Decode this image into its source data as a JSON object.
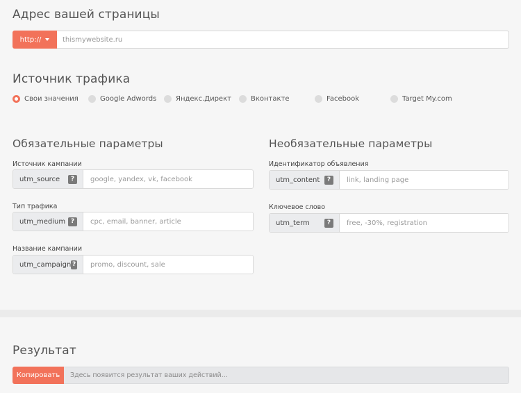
{
  "address": {
    "title": "Адрес вашей страницы",
    "protocol": "http://",
    "url_placeholder": "thismywebsite.ru"
  },
  "traffic": {
    "title": "Источник трафика",
    "options": [
      {
        "label": "Свои значения",
        "selected": true
      },
      {
        "label": "Google Adwords",
        "selected": false
      },
      {
        "label": "Яндекс.Директ",
        "selected": false
      },
      {
        "label": "Вконтакте",
        "selected": false
      },
      {
        "label": "Facebook",
        "selected": false
      },
      {
        "label": "Target My.com",
        "selected": false
      }
    ]
  },
  "required": {
    "title": "Обязательные параметры",
    "fields": [
      {
        "label": "Источник кампании",
        "param": "utm_source",
        "placeholder": "google, yandex, vk, facebook",
        "help": "?"
      },
      {
        "label": "Тип трафика",
        "param": "utm_medium",
        "placeholder": "cpc, email, banner, article",
        "help": "?"
      },
      {
        "label": "Название кампании",
        "param": "utm_campaign",
        "placeholder": "promo, discount, sale",
        "help": "?"
      }
    ]
  },
  "optional": {
    "title": "Необязательные параметры",
    "fields": [
      {
        "label": "Идентификатор объявления",
        "param": "utm_content",
        "placeholder": "link, landing page",
        "help": "?"
      },
      {
        "label": "Ключевое слово",
        "param": "utm_term",
        "placeholder": "free, -30%, registration",
        "help": "?"
      }
    ]
  },
  "result": {
    "title": "Результат",
    "copy_label": "Копировать",
    "placeholder_text": "Здесь появится результат ваших действий..."
  },
  "colors": {
    "accent": "#f2725a",
    "addon_bg": "#ebecee",
    "page_bg": "#f6f6f6"
  }
}
